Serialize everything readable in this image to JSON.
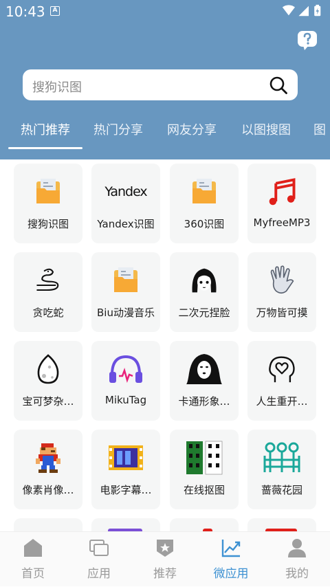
{
  "status_bar": {
    "time": "10:43",
    "notification_badge": "A"
  },
  "header": {
    "help_icon": "question-bubble-icon"
  },
  "search": {
    "placeholder": "搜狗识图",
    "icon": "search-icon"
  },
  "tabs": [
    {
      "label": "热门推荐",
      "active": true
    },
    {
      "label": "热门分享",
      "active": false
    },
    {
      "label": "网友分享",
      "active": false
    },
    {
      "label": "以图搜图",
      "active": false
    },
    {
      "label": "图",
      "active": false
    }
  ],
  "apps": [
    {
      "label": "搜狗识图",
      "icon": "folder-icon"
    },
    {
      "label": "Yandex识图",
      "icon": "yandex-logo",
      "logo_text": "Yandex"
    },
    {
      "label": "360识图",
      "icon": "folder-icon"
    },
    {
      "label": "MyfreeMP3",
      "icon": "music-note-icon"
    },
    {
      "label": "贪吃蛇",
      "icon": "snake-icon"
    },
    {
      "label": "Biu动漫音乐",
      "icon": "folder-icon"
    },
    {
      "label": "二次元捏脸",
      "icon": "anime-face-icon"
    },
    {
      "label": "万物皆可摸",
      "icon": "hand-icon"
    },
    {
      "label": "宝可梦杂…",
      "icon": "egg-icon"
    },
    {
      "label": "MikuTag",
      "icon": "headphones-icon"
    },
    {
      "label": "卡通形象…",
      "icon": "mask-icon"
    },
    {
      "label": "人生重开…",
      "icon": "head-heart-icon"
    },
    {
      "label": "像素肖像…",
      "icon": "pixel-character-icon"
    },
    {
      "label": "电影字幕…",
      "icon": "film-strip-icon"
    },
    {
      "label": "在线抠图",
      "icon": "cutout-strip-icon"
    },
    {
      "label": "蔷薇花园",
      "icon": "garden-icon"
    }
  ],
  "bottom_nav": [
    {
      "label": "首页",
      "icon": "home-icon",
      "active": false
    },
    {
      "label": "应用",
      "icon": "apps-icon",
      "active": false
    },
    {
      "label": "推荐",
      "icon": "badge-star-icon",
      "active": false
    },
    {
      "label": "微应用",
      "icon": "trend-chart-icon",
      "active": true
    },
    {
      "label": "我的",
      "icon": "profile-icon",
      "active": false
    }
  ],
  "colors": {
    "header": "#6897c0",
    "active_nav": "#3d91d2",
    "card_bg": "#f5f6f6"
  }
}
